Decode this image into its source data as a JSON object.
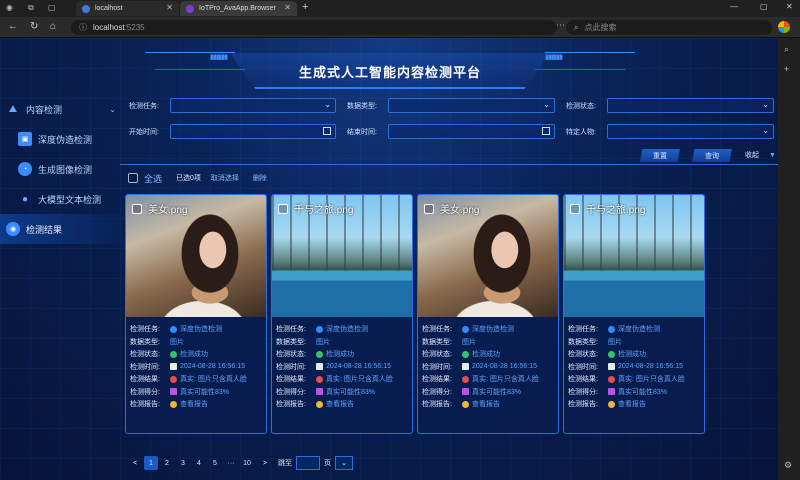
{
  "browser": {
    "tabs": [
      {
        "label": "localhost"
      },
      {
        "label": "IoTPro_AvaApp.Browser"
      }
    ],
    "url_host": "localhost",
    "url_port": ":5235",
    "search_placeholder": "点此搜索"
  },
  "app": {
    "title": "生成式人工智能内容检测平台",
    "menu": {
      "group": "内容检测",
      "items": [
        "深度伪造检测",
        "生成图像检测",
        "大模型文本检测",
        "检测结果"
      ]
    },
    "filters": {
      "task_label": "检测任务:",
      "type_label": "数据类型:",
      "status_label": "检测状态:",
      "start_label": "开始时间:",
      "end_label": "结束时间:",
      "person_label": "特定人物:"
    },
    "buttons": {
      "reset": "重置",
      "query": "查询",
      "collapse": "收起"
    },
    "selection": {
      "select_all": "全选",
      "selected": "已选0项",
      "cancel": "取消选择",
      "delete": "删除"
    },
    "card_keys": {
      "task": "检测任务:",
      "type": "数据类型:",
      "status": "检测状态:",
      "time": "检测时间:",
      "result": "检测结果:",
      "score": "检测得分:",
      "report": "检测报告:"
    },
    "cards": [
      {
        "name": "美女.png",
        "task": "深度伪造检测",
        "type": "图片",
        "status": "检测成功",
        "time": "2024-08-28 16:56:15",
        "result": "真实: 图片只含真人脸",
        "score": "真实可能性83%",
        "report": "查看报告"
      },
      {
        "name": "千与之旅.png",
        "task": "深度伪造检测",
        "type": "图片",
        "status": "检测成功",
        "time": "2024-08-28 16:56:15",
        "result": "真实: 图片只含真人脸",
        "score": "真实可能性83%",
        "report": "查看报告"
      },
      {
        "name": "美女.png",
        "task": "深度伪造检测",
        "type": "图片",
        "status": "检测成功",
        "time": "2024-08-28 16:56:15",
        "result": "真实: 图片只含真人脸",
        "score": "真实可能性83%",
        "report": "查看报告"
      },
      {
        "name": "千与之旅.png",
        "task": "深度伪造检测",
        "type": "图片",
        "status": "检测成功",
        "time": "2024-08-28 16:56:15",
        "result": "真实: 图片只含真人脸",
        "score": "真实可能性83%",
        "report": "查看报告"
      }
    ],
    "pagination": {
      "prev": "<",
      "pages": [
        "1",
        "2",
        "3",
        "4",
        "5",
        "···",
        "10"
      ],
      "next": ">",
      "jump_label": "跳至",
      "page_unit": "页"
    },
    "colors": {
      "accent": "#2d7bff",
      "blue_dot": "#2f8cff",
      "green_dot": "#35c46a",
      "red_dot": "#e84b4b",
      "purple_sq": "#b455e8",
      "yellow_dot": "#f2b632"
    }
  }
}
